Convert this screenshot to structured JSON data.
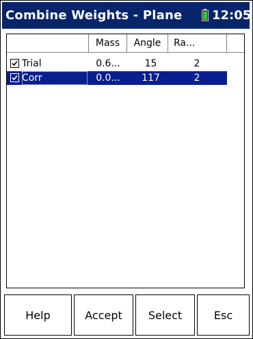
{
  "titlebar": {
    "title": "Combine Weights - Plane",
    "time": "12:05",
    "battery_icon": "battery-icon",
    "battery_color": "#3cc23c",
    "background": "#08246b"
  },
  "table": {
    "columns": [
      "",
      "Mass",
      "Angle",
      "Ra..."
    ],
    "rows": [
      {
        "checked": true,
        "name": "Trial",
        "mass": "0.6...",
        "angle": "15",
        "radius": "2",
        "selected": false
      },
      {
        "checked": true,
        "name": "Corr",
        "mass": "0.0...",
        "angle": "117",
        "radius": "2",
        "selected": true
      }
    ],
    "selection_color": "#0a1f8f"
  },
  "buttons": {
    "help": "Help",
    "accept": "Accept",
    "select": "Select",
    "esc": "Esc"
  }
}
